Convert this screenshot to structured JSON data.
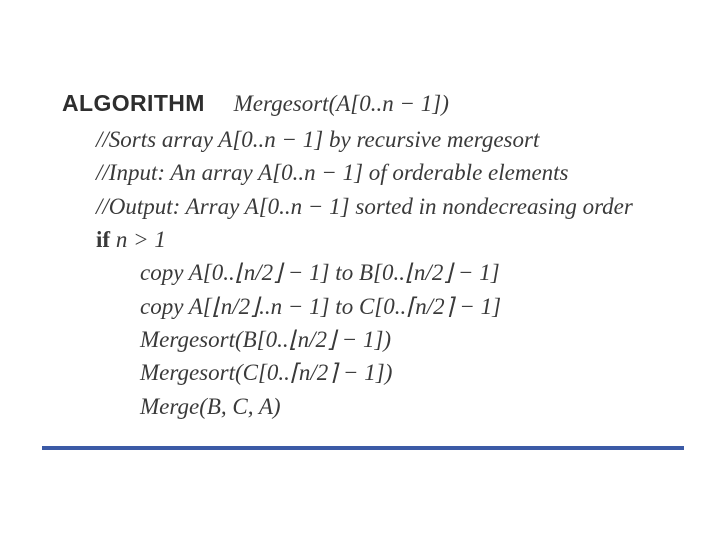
{
  "heading": {
    "label": "ALGORITHM",
    "func": "Mergesort",
    "args": "(A[0..n − 1])"
  },
  "lines": {
    "c1": "//Sorts array A[0..n − 1] by recursive mergesort",
    "c2": "//Input: An array A[0..n − 1] of orderable elements",
    "c3": "//Output: Array A[0..n − 1] sorted in nondecreasing order",
    "if_kw": "if",
    "if_cond": " n > 1",
    "b1a": "copy A[0..⌊n/2⌋ − 1] to B[0..⌊n/2⌋ − 1]",
    "b2a": "copy A[⌊n/2⌋..n − 1] to C[0..⌈n/2⌉ − 1]",
    "b3f": "Mergesort",
    "b3a": "(B[0..⌊n/2⌋ − 1])",
    "b4f": "Mergesort",
    "b4a": "(C[0..⌈n/2⌉ − 1])",
    "b5f": "Merge",
    "b5a": "(B, C, A)"
  }
}
